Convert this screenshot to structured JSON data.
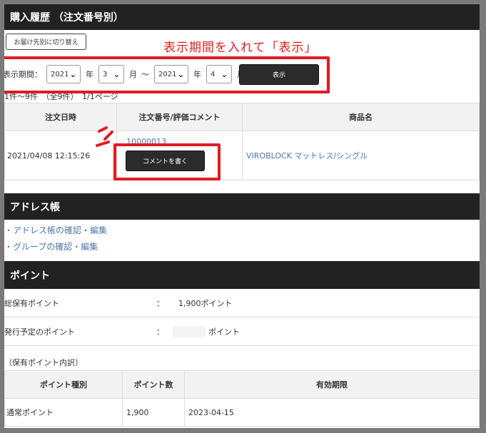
{
  "purchase": {
    "title": "購入履歴 （注文番号別）",
    "switch_label": "お届け先別に切り替え",
    "annotation": "表示期間を入れて「表示」",
    "period_label": "表示期間：",
    "from_year": "2021",
    "from_month": "3",
    "to_year": "2021",
    "to_month": "4",
    "unit_year": "年",
    "unit_month": "月",
    "tilde": "～",
    "show_button": "表示",
    "count_text": "1件～9件　（全9件）　1/1ページ",
    "table": {
      "headers": [
        "注文日時",
        "注文番号/評価コメント",
        "商品名"
      ],
      "rows": [
        {
          "date": "2021/04/08 12:15:26",
          "order_no": "10000013",
          "comment_button": "コメントを書く",
          "product": "VIROBLOCK マットレス/シングル"
        }
      ]
    }
  },
  "address": {
    "title": "アドレス帳",
    "links": [
      "アドレス帳の確認・編集",
      "グループの確認・編集"
    ]
  },
  "points": {
    "title": "ポイント",
    "total_label": "総保有ポイント",
    "total_value": "1,900ポイント",
    "scheduled_label": "発行予定のポイント",
    "scheduled_unit": "ポイント",
    "colon": "：",
    "breakdown_label": "（保有ポイント内訳）",
    "table": {
      "headers": [
        "ポイント種別",
        "ポイント数",
        "有効期限"
      ],
      "rows": [
        {
          "type": "通常ポイント",
          "count": "1,900",
          "expiry": "2023-04-15"
        }
      ]
    }
  },
  "colors": {
    "header_bg": "#222222",
    "annotation_red": "#e01b24",
    "link": "#4f77a6"
  }
}
